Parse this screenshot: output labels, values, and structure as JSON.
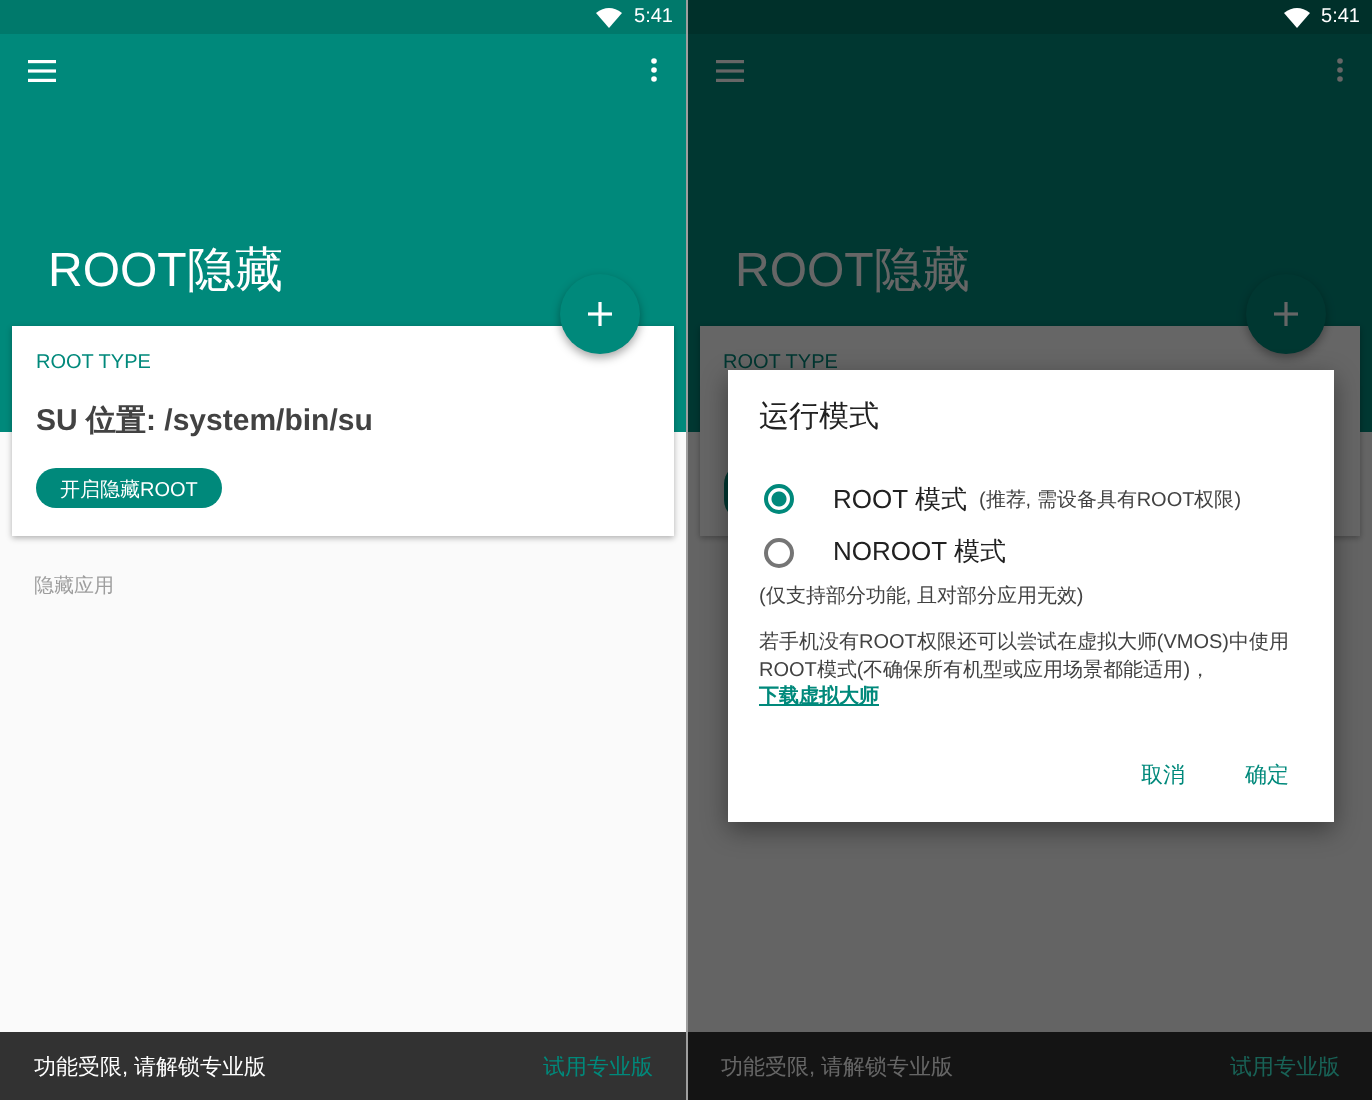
{
  "screens": [
    {
      "status_time": "5:41",
      "title": "ROOT隐藏",
      "card": {
        "label": "ROOT TYPE",
        "location": "SU 位置: /system/bin/su",
        "button": "开启隐藏ROOT"
      },
      "section_label": "隐藏应用",
      "snackbar": {
        "message": "功能受限, 请解锁专业版",
        "action": "试用专业版"
      }
    },
    {
      "status_time": "5:41",
      "title": "ROOT隐藏",
      "card": {
        "label": "ROOT TYPE"
      },
      "snackbar": {
        "message": "功能受限, 请解锁专业版",
        "action": "试用专业版"
      },
      "dialog": {
        "title": "运行模式",
        "options": [
          {
            "label": "ROOT 模式",
            "note": "(推荐, 需设备具有ROOT权限)",
            "selected": true
          },
          {
            "label": "NOROOT 模式",
            "note": "(仅支持部分功能, 且对部分应用无效)",
            "selected": false
          }
        ],
        "text": "若手机没有ROOT权限还可以尝试在虚拟大师(VMOS)中使用ROOT模式(不确保所有机型或应用场景都能适用)，",
        "link": "下载虚拟大师",
        "buttons": [
          "取消",
          "确定"
        ]
      }
    }
  ]
}
